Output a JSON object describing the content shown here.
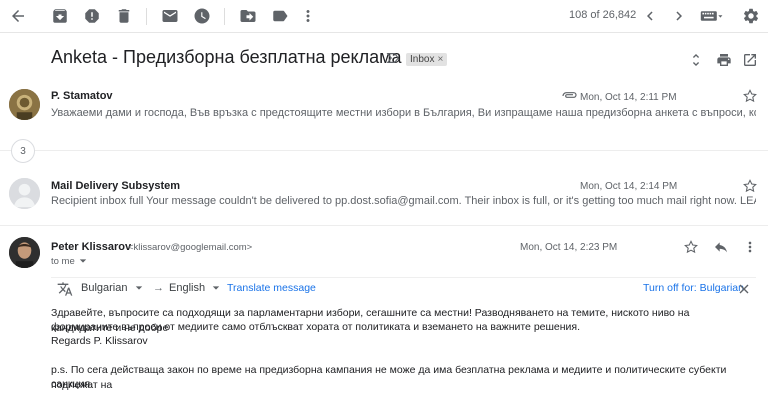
{
  "toolbar": {
    "icons": [
      "back-arrow-icon",
      "archive-icon",
      "report-spam-icon",
      "delete-icon",
      "mark-unread-icon",
      "snooze-icon",
      "move-to-icon",
      "label-icon",
      "more-vert-icon"
    ],
    "pager": "108 of 26,842",
    "right_icons": [
      "newer-icon",
      "older-icon",
      "input-tools-icon",
      "settings-icon"
    ]
  },
  "subject": {
    "text": "Anketa - Предизборна безплатна реклама",
    "label": "Inbox",
    "label_remove": "×"
  },
  "messages": [
    {
      "sender": "P. Stamatov",
      "date": "Mon, Oct 14, 2:11 PM",
      "snippet": "Уважаеми дами и господа, Във връзка с предстоящите местни избори в България, Ви изпращаме наша предизборна анкета с въпроси, които можете…",
      "has_attachment": true
    },
    {
      "sender": "Mail Delivery Subsystem",
      "date": "Mon, Oct 14, 2:14 PM",
      "snippet": "Recipient inbox full Your message couldn't be delivered to pp.dost.sofia@gmail.com. Their inbox is full, or it's getting too much mail right now. LEARN MORE …"
    }
  ],
  "collapsed_count": "3",
  "open_message": {
    "sender": "Peter Klissarov",
    "email": "<klissarov@googlemail.com>",
    "date": "Mon, Oct 14, 2:23 PM",
    "to": "to me",
    "translate": {
      "from_lang": "Bulgarian",
      "arrow": "→",
      "to_lang": "English",
      "translate_link": "Translate message",
      "turn_off": "Turn off for: Bulgarian"
    },
    "body_line1": "Здравейте, въпросите са подходящи за парламентарни избори, сегашните са местни! Разводняването на темите, ниското ниво на кандидатите и не добре",
    "body_line2": "формираните въпроси от медиите само отблъскват хората от политиката и вземането на важните решения.",
    "body_line3": "Regards P. Klissarov",
    "body_line4": "p.s. По сега действаща закон по време на предизборна кампания не може да има безплатна реклама и медиите и политическите субекти подлежат на",
    "body_line5": "санкция."
  },
  "colors": {
    "link": "#1a73e8",
    "icon": "#5f6368",
    "label_bg": "#e2e2e2"
  }
}
